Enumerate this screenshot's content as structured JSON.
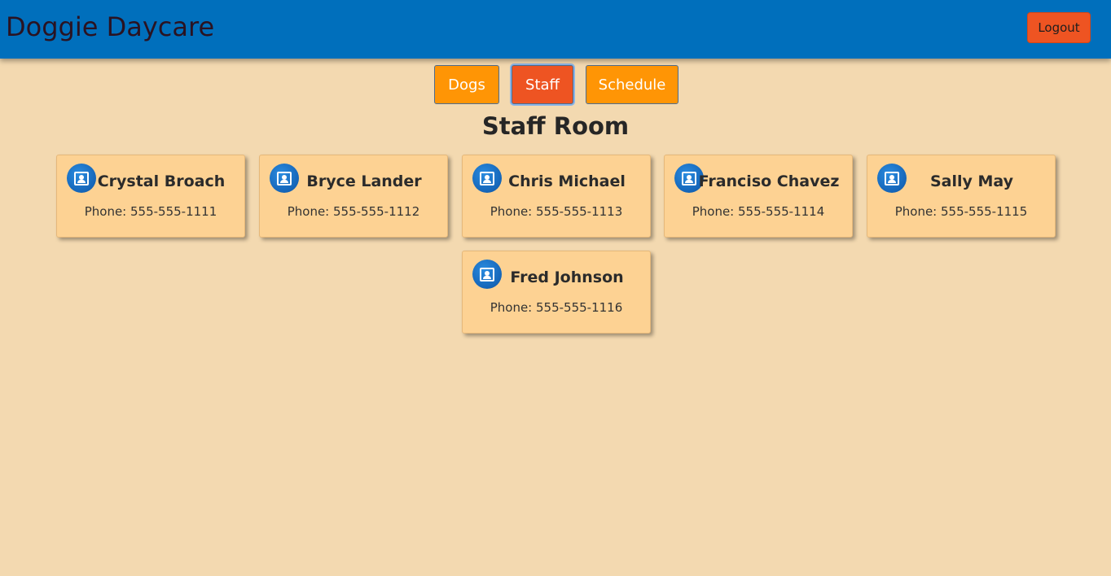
{
  "header": {
    "title": "Doggie Daycare",
    "logout_label": "Logout"
  },
  "nav": {
    "tabs": [
      {
        "label": "Dogs",
        "active": false
      },
      {
        "label": "Staff",
        "active": true
      },
      {
        "label": "Schedule",
        "active": false
      }
    ]
  },
  "main": {
    "title": "Staff Room",
    "phone_prefix": "Phone:",
    "staff": [
      {
        "name": "Crystal Broach",
        "phone": "Phone: 555-555-1111"
      },
      {
        "name": "Bryce Lander",
        "phone": "Phone: 555-555-1112"
      },
      {
        "name": "Chris Michael",
        "phone": "Phone: 555-555-1113"
      },
      {
        "name": "Franciso Chavez",
        "phone": "Phone: 555-555-1114"
      },
      {
        "name": "Sally May",
        "phone": "Phone: 555-555-1115"
      },
      {
        "name": "Fred Johnson",
        "phone": "Phone: 555-555-1116"
      }
    ]
  },
  "icons": {
    "avatar": "contact-icon"
  },
  "colors": {
    "header_bg": "#006fbc",
    "page_bg": "#f3d9b0",
    "card_bg": "#fdd293",
    "nav_button": "#ff9505",
    "accent": "#ee5422"
  }
}
